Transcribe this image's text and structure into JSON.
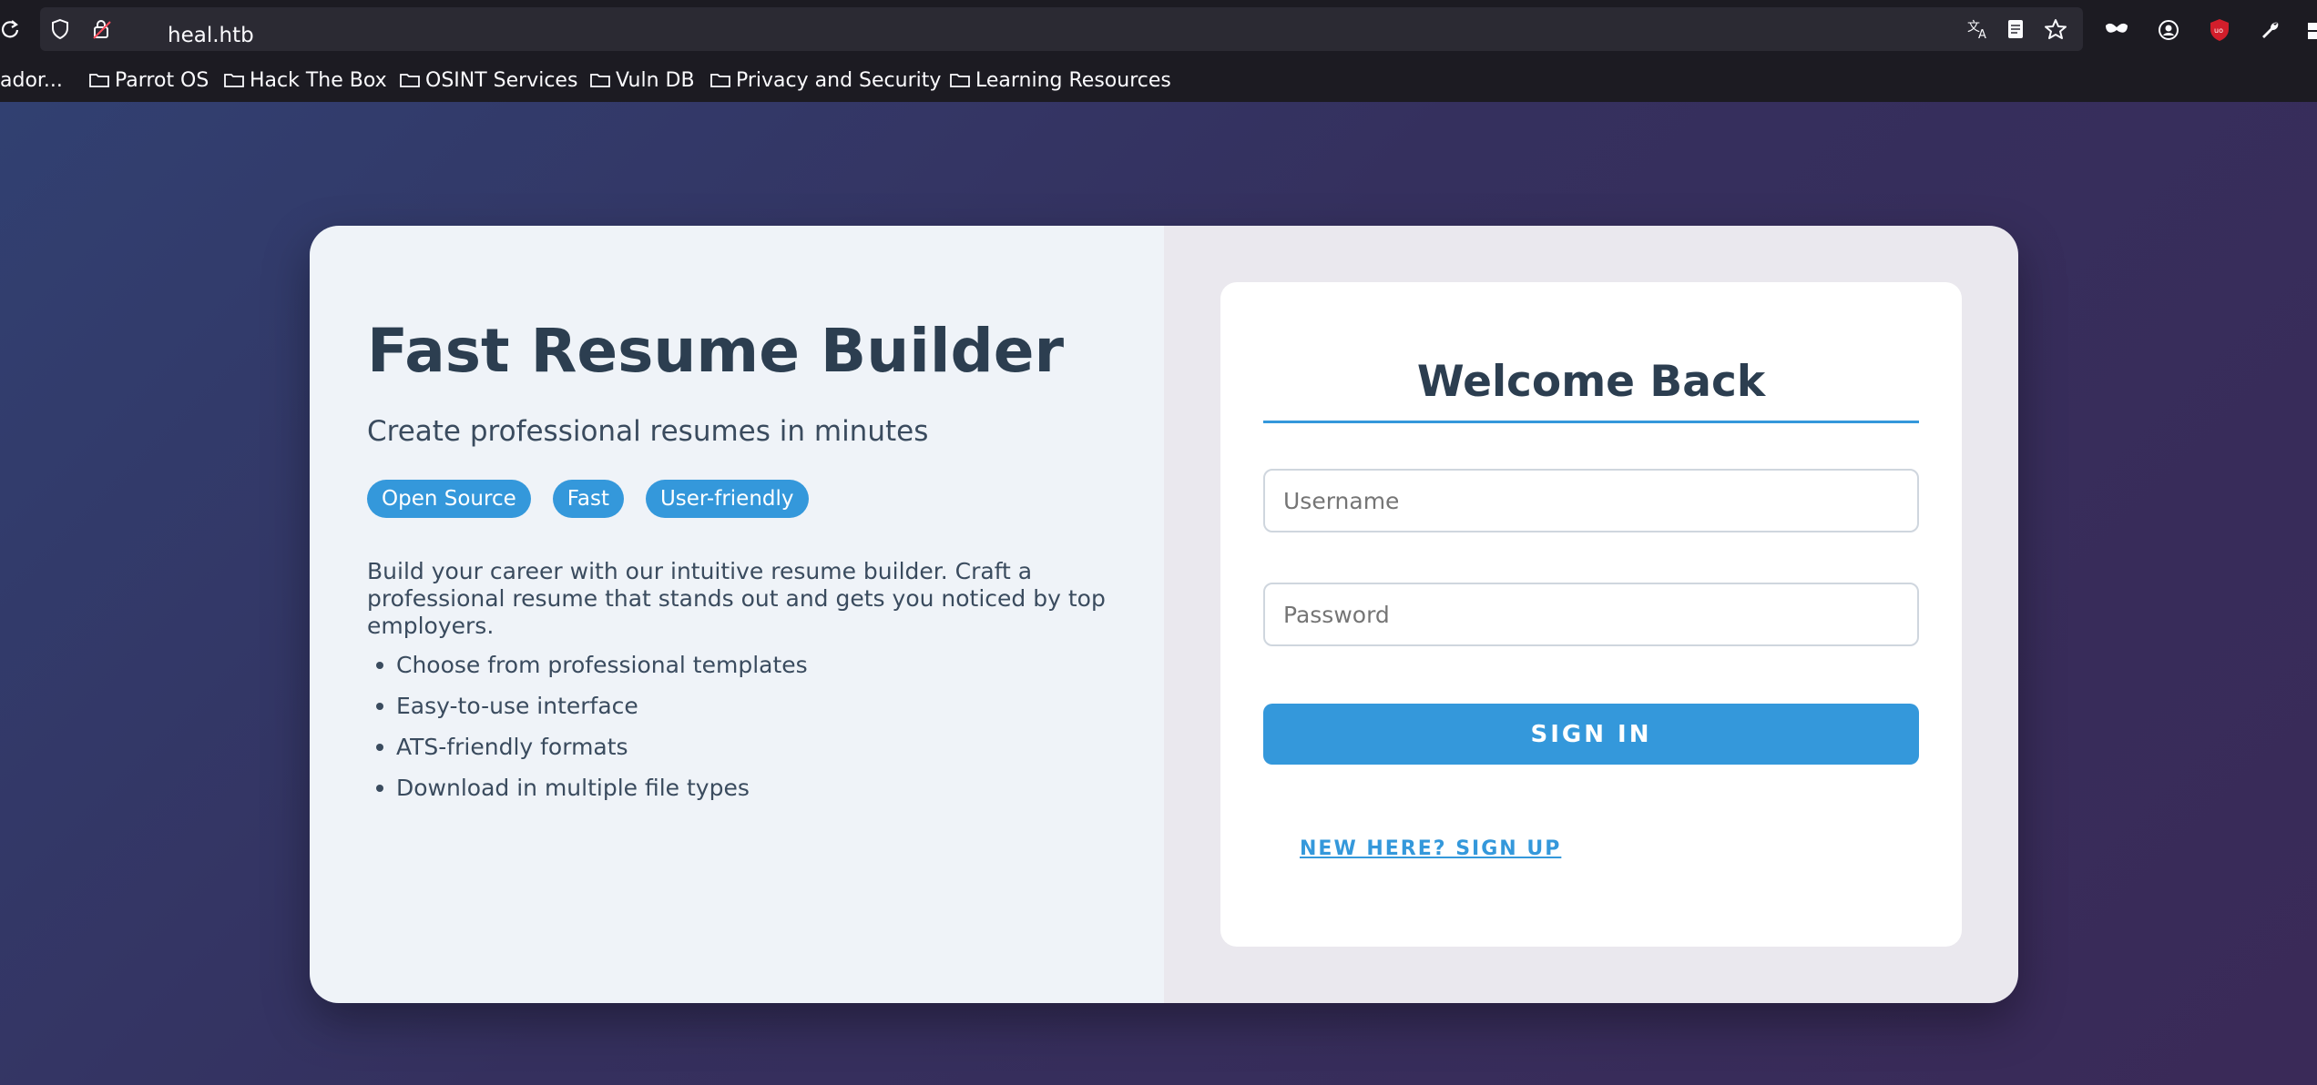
{
  "browser": {
    "url": "heal.htb",
    "bookmarks": [
      {
        "label": "ador..."
      },
      {
        "label": "Parrot OS"
      },
      {
        "label": "Hack The Box"
      },
      {
        "label": "OSINT Services"
      },
      {
        "label": "Vuln DB"
      },
      {
        "label": "Privacy and Security"
      },
      {
        "label": "Learning Resources"
      }
    ],
    "icons": [
      "reload-icon",
      "shield-icon",
      "lock-icon",
      "translate-icon",
      "reader-icon",
      "star-icon",
      "mask-icon",
      "account-icon",
      "ublock-icon",
      "wrench-icon",
      "extensions-icon"
    ]
  },
  "hero": {
    "title": "Fast Resume Builder",
    "subtitle": "Create professional resumes in minutes",
    "tags": [
      "Open Source",
      "Fast",
      "User-friendly"
    ],
    "description": "Build your career with our intuitive resume builder. Craft a professional resume that stands out and gets you noticed by top employers.",
    "features": [
      "Choose from professional templates",
      "Easy-to-use interface",
      "ATS-friendly formats",
      "Download in multiple file types"
    ]
  },
  "login": {
    "title": "Welcome Back",
    "username_placeholder": "Username",
    "password_placeholder": "Password",
    "signin_label": "SIGN IN",
    "signup_label": "NEW HERE? SIGN UP"
  },
  "colors": {
    "accent": "#3498db",
    "heading": "#2c3e50",
    "page_gradient_start": "#314071",
    "page_gradient_end": "#3a2a58"
  }
}
